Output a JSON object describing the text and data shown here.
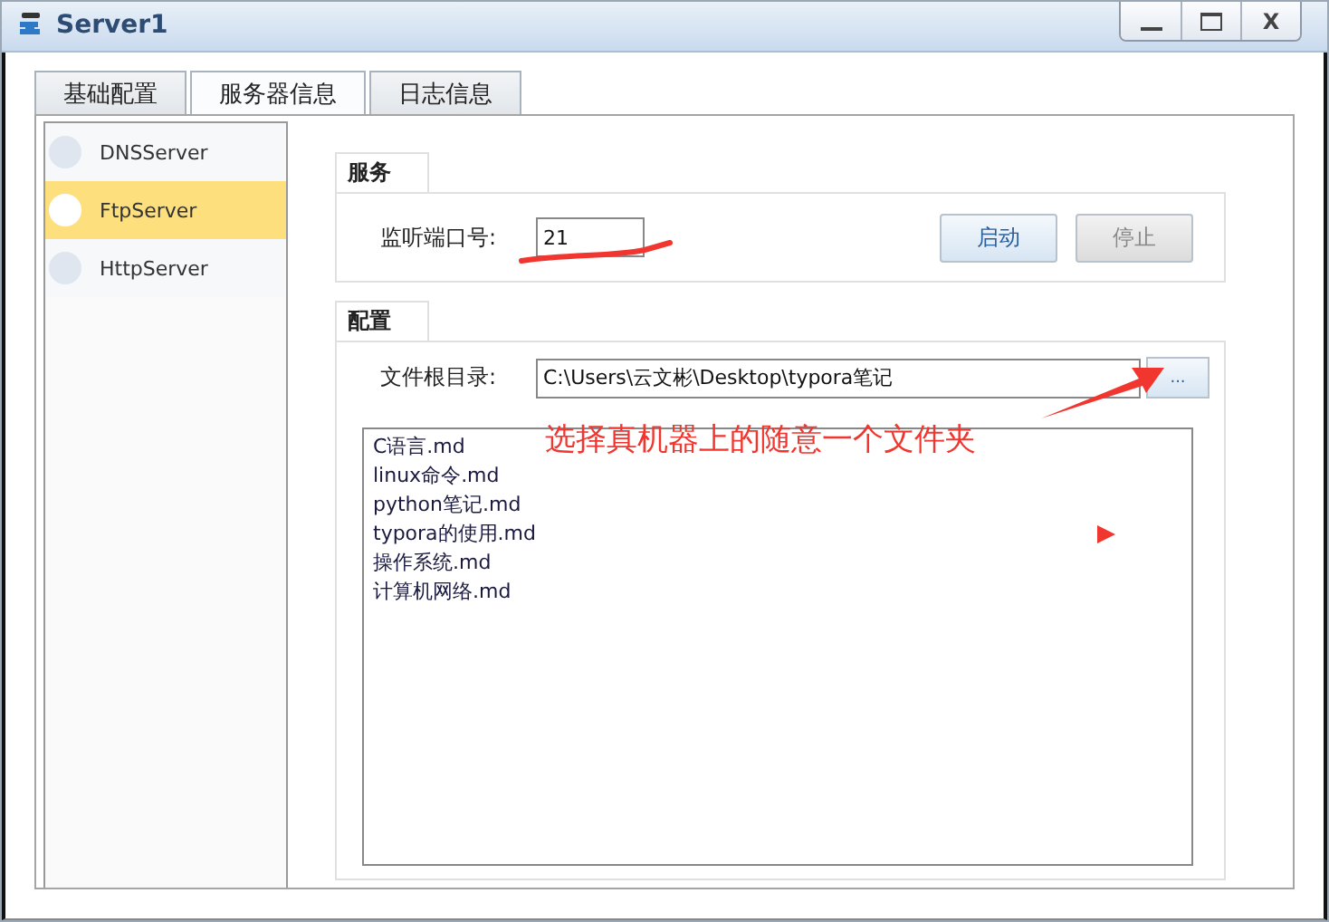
{
  "window": {
    "title": "Server1"
  },
  "window_controls": [
    {
      "kind": "minimize"
    },
    {
      "kind": "maximize"
    },
    {
      "kind": "close",
      "label": "X"
    }
  ],
  "tabs": [
    {
      "label": "基础配置",
      "selected": false
    },
    {
      "label": "服务器信息",
      "selected": true
    },
    {
      "label": "日志信息",
      "selected": false
    }
  ],
  "services": [
    {
      "name": "DNSServer",
      "selected": false
    },
    {
      "name": "FtpServer",
      "selected": true
    },
    {
      "name": "HttpServer",
      "selected": false
    }
  ],
  "service_group": {
    "title": "服务",
    "port_label": "监听端口号:",
    "port_value": "21",
    "buttons": [
      {
        "label": "启动",
        "disabled": false
      },
      {
        "label": "停止",
        "disabled": true
      }
    ]
  },
  "config_group": {
    "title": "配置",
    "root_label": "文件根目录:",
    "root_value": "C:\\Users\\云文彬\\Desktop\\typora笔记",
    "browse_label": "...",
    "files": [
      "C语言.md",
      "linux命令.md",
      "python笔记.md",
      "typora的使用.md",
      "操作系统.md",
      "计算机网络.md"
    ]
  },
  "annotation": {
    "text": "选择真机器上的随意一个文件夹"
  }
}
